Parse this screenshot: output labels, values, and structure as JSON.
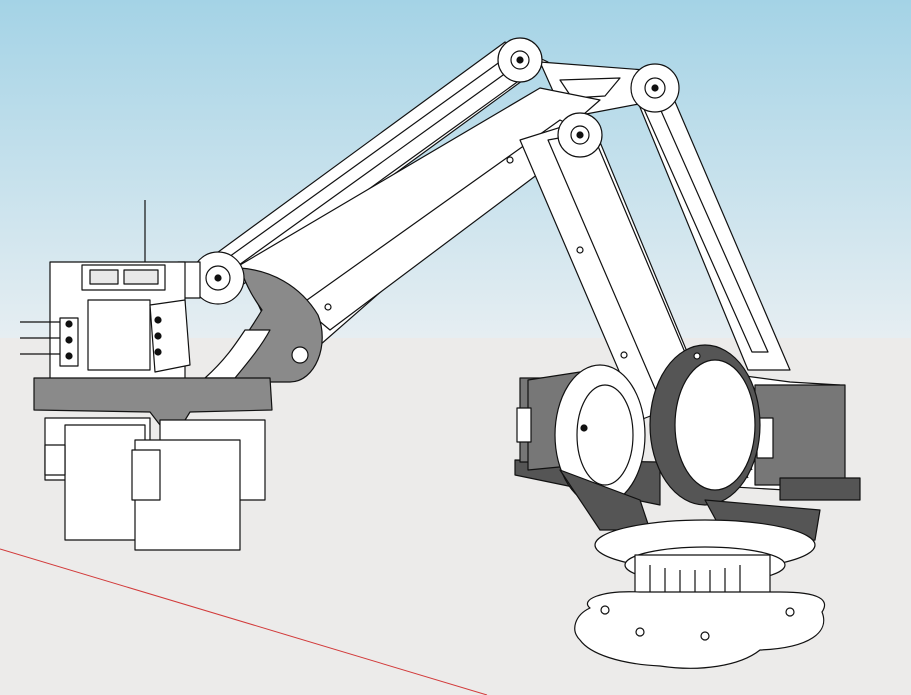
{
  "viewport": {
    "sky_top_color": "#a4d3e6",
    "sky_bottom_color": "#e6eef2",
    "ground_color": "#ecebea",
    "axis_line_color": "#d23a3a",
    "model_fill_color": "#ffffff",
    "model_edge_color": "#111111",
    "shadow_gray_color": "#8a8a8a",
    "dark_part_color": "#555555"
  },
  "model": {
    "object": "palletizing-robot-arm",
    "parts": [
      "base-plate",
      "rotating-turret",
      "stepper-motor-left",
      "stepper-motor-right",
      "upper-arm-link",
      "forearm-link",
      "parallel-link",
      "wrist-gripper-assembly"
    ]
  }
}
